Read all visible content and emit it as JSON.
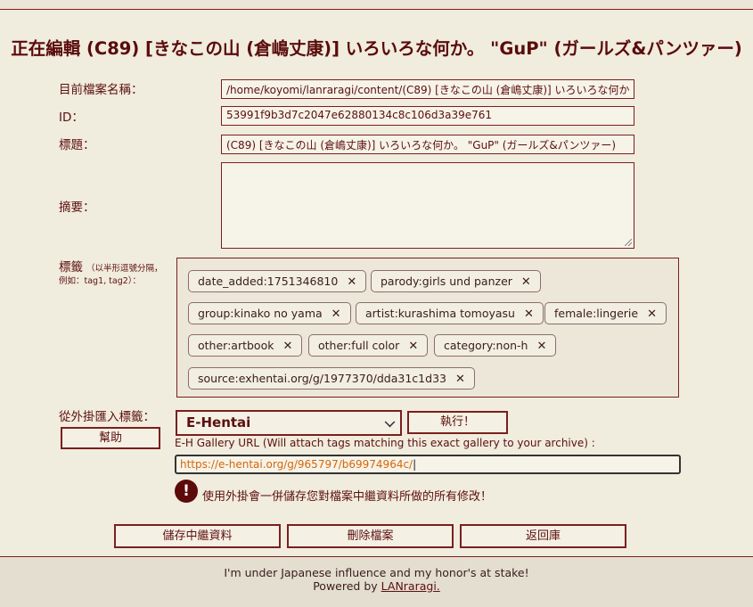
{
  "title": "正在編輯 (C89) [きなこの山 (倉嶋丈康)] いろいろな何か。 \"GuP\" (ガールズ&パンツァー)",
  "fields": {
    "filename_label": "目前檔案名稱：",
    "filename_value": "/home/koyomi/lanraragi/content/(C89) [きなこの山 (倉嶋丈康)] いろいろな何か",
    "id_label": "ID：",
    "id_value": "53991f9b3d7c2047e62880134c8c106d3a39e761",
    "title_label": "標題：",
    "title_value": "(C89) [きなこの山 (倉嶋丈康)] いろいろな何か。 \"GuP\" (ガールズ&パンツァー)",
    "summary_label": "摘要：",
    "tags_label": "標籤",
    "tags_hint1": "（以半形逗號分隔，",
    "tags_hint2": "例如：tag1, tag2）："
  },
  "tags": [
    "date_added:1751346810",
    "parody:girls und panzer",
    "group:kinako no yama",
    "artist:kurashima tomoyasu",
    "female:lingerie",
    "other:artbook",
    "other:full color",
    "category:non-h",
    "source:exhentai.org/g/1977370/dda31c1d33"
  ],
  "tag_remove_glyph": "✕",
  "plugin": {
    "label": "從外掛匯入標籤：",
    "help_button": "幫助",
    "selected": "E-Hentai",
    "run_button": "執行！",
    "url_label": "E-H Gallery URL (Will attach tags matching this exact gallery to your archive) :",
    "url_value": "https://e-hentai.org/g/965797/b69974964c/",
    "warning_icon": "!",
    "warning_text": "使用外掛會一併儲存您對檔案中繼資料所做的所有修改！"
  },
  "actions": {
    "save": "儲存中繼資料",
    "delete": "刪除檔案",
    "back": "返回庫"
  },
  "footer": {
    "line1": "I'm under Japanese influence and my honor's at stake!",
    "powered_prefix": "Powered by ",
    "powered_link": "LANraragi."
  }
}
